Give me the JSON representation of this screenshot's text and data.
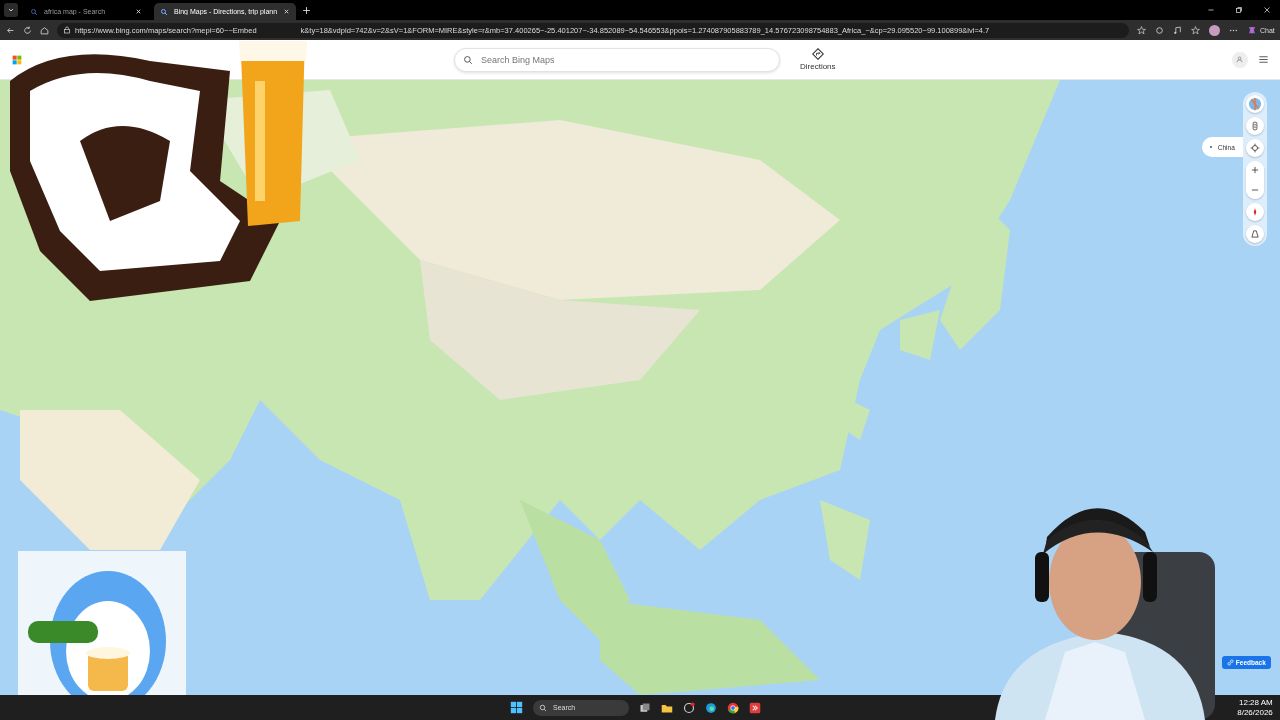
{
  "browser": {
    "tabs": [
      {
        "title": "africa map - Search",
        "selected": false
      },
      {
        "title": "Bing Maps - Directions, trip plann",
        "selected": true
      }
    ],
    "address": {
      "url_start": "https://www.bing.com/maps/search?mepi=60~~Embed",
      "url_end": "k&ty=18&vdpid=742&v=2&sV=1&FORM=MIRE&style=r&mb=37.400265~-25.401207~-34.852089~54.546553&ppois=1.274087905883789_14.576723098754883_Africa_~&cp=29.095520~99.100899&lvl=4.7"
    },
    "chat_label": "Chat"
  },
  "maps": {
    "search": {
      "placeholder": "Search Bing Maps"
    },
    "directions_label": "Directions",
    "location_chip": "China",
    "feedback_label": "Feedback"
  },
  "taskbar": {
    "search_label": "Search",
    "time": "12:28 AM",
    "date": "8/26/2026"
  }
}
